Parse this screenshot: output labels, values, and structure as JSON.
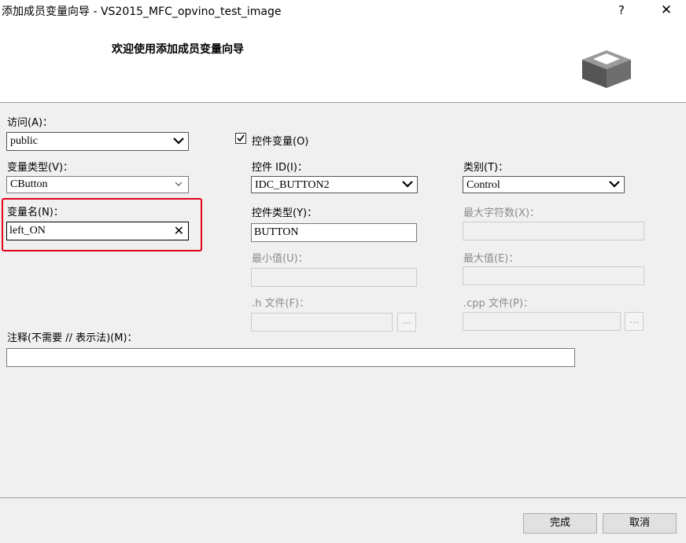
{
  "window": {
    "title": "添加成员变量向导 - VS2015_MFC_opvino_test_image",
    "help": "?",
    "close": "✕"
  },
  "header": {
    "title": "欢迎使用添加成员变量向导",
    "icon": "wizard-box-icon"
  },
  "access": {
    "label": "访问(A)：",
    "value": "public"
  },
  "var_type": {
    "label": "变量类型(V)：",
    "value": "CButton"
  },
  "var_name": {
    "label": "变量名(N)：",
    "value": "left_ON"
  },
  "control_var": {
    "label": "控件变量(O)",
    "checked": true
  },
  "control_id": {
    "label": "控件 ID(I)：",
    "value": "IDC_BUTTON2"
  },
  "category": {
    "label": "类别(T)：",
    "value": "Control"
  },
  "control_type": {
    "label": "控件类型(Y)：",
    "value": "BUTTON"
  },
  "max_chars": {
    "label": "最大字符数(X)：",
    "value": ""
  },
  "min_value": {
    "label": "最小值(U)：",
    "value": ""
  },
  "max_value": {
    "label": "最大值(E)：",
    "value": ""
  },
  "h_file": {
    "label": ".h 文件(F)：",
    "value": "",
    "browse": "..."
  },
  "cpp_file": {
    "label": ".cpp 文件(P)：",
    "value": "",
    "browse": "..."
  },
  "comment": {
    "label": "注释(不需要 // 表示法)(M)：",
    "value": ""
  },
  "buttons": {
    "finish": "完成",
    "cancel": "取消"
  }
}
